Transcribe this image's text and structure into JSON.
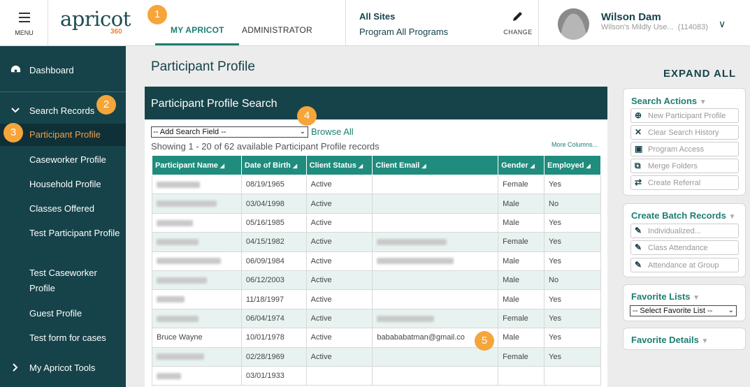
{
  "topbar": {
    "menu_label": "MENU",
    "logo_text": "apricot",
    "logo_sub": "360",
    "tab_my": "MY APRICOT",
    "tab_admin": "ADMINISTRATOR",
    "sites_title": "All Sites",
    "sites_program": "Program All Programs",
    "change_label": "CHANGE",
    "user_name": "Wilson Dam",
    "user_sub": "Wilson's Mildly Use...",
    "user_id": "(114083)"
  },
  "sidebar": {
    "dashboard": "Dashboard",
    "search_records": "Search Records",
    "items": [
      "Participant Profile",
      "Caseworker Profile",
      "Household Profile",
      "Classes Offered",
      "Test Participant Profile",
      "Test Caseworker Profile",
      "Guest Profile",
      "Test form for cases"
    ],
    "my_tools": "My Apricot Tools"
  },
  "main": {
    "page_title": "Participant Profile",
    "expand_all": "EXPAND ALL",
    "panel_title": "Participant Profile Search",
    "add_field": "-- Add Search Field --",
    "browse_all": "Browse All",
    "showing": "Showing 1 - 20 of 62 available Participant Profile records",
    "more_columns": "More Columns...",
    "columns": [
      "Participant Name",
      "Date of Birth",
      "Client Status",
      "Client Email",
      "Gender",
      "Employed"
    ],
    "rows": [
      {
        "name": "",
        "dob": "08/19/1965",
        "status": "Active",
        "email": "",
        "gender": "Female",
        "employed": "Yes"
      },
      {
        "name": "",
        "dob": "03/04/1998",
        "status": "Active",
        "email": "",
        "gender": "Male",
        "employed": "No"
      },
      {
        "name": "",
        "dob": "05/16/1985",
        "status": "Active",
        "email": "",
        "gender": "Male",
        "employed": "Yes"
      },
      {
        "name": "",
        "dob": "04/15/1982",
        "status": "Active",
        "email": "",
        "gender": "Female",
        "employed": "Yes"
      },
      {
        "name": "",
        "dob": "06/09/1984",
        "status": "Active",
        "email": "",
        "gender": "Male",
        "employed": "Yes"
      },
      {
        "name": "",
        "dob": "06/12/2003",
        "status": "Active",
        "email": "",
        "gender": "Male",
        "employed": "No"
      },
      {
        "name": "",
        "dob": "11/18/1997",
        "status": "Active",
        "email": "",
        "gender": "Male",
        "employed": "Yes"
      },
      {
        "name": "",
        "dob": "06/04/1974",
        "status": "Active",
        "email": "",
        "gender": "Female",
        "employed": "Yes"
      },
      {
        "name": "Bruce Wayne",
        "dob": "10/01/1978",
        "status": "Active",
        "email": "babababatman@gmail.co",
        "gender": "Male",
        "employed": "Yes"
      },
      {
        "name": "",
        "dob": "02/28/1969",
        "status": "Active",
        "email": "",
        "gender": "Female",
        "employed": "Yes"
      },
      {
        "name": "",
        "dob": "03/01/1933",
        "status": "",
        "email": "",
        "gender": "",
        "employed": ""
      }
    ]
  },
  "right": {
    "search_actions": "Search Actions",
    "new_profile": "New Participant Profile",
    "clear_history": "Clear Search History",
    "program_access": "Program Access",
    "merge_folders": "Merge Folders",
    "create_referral": "Create Referral",
    "batch_title": "Create Batch Records",
    "individualized": "Individualized...",
    "class_attendance": "Class Attendance",
    "attendance_group": "Attendance at Group",
    "favorite_lists": "Favorite Lists",
    "select_favorite": "-- Select Favorite List --",
    "favorite_details": "Favorite Details"
  },
  "callouts": [
    "1",
    "2",
    "3",
    "4",
    "5"
  ],
  "colors": {
    "teal_dark": "#16434a",
    "teal": "#1d7e72",
    "orange": "#f5a53a"
  }
}
